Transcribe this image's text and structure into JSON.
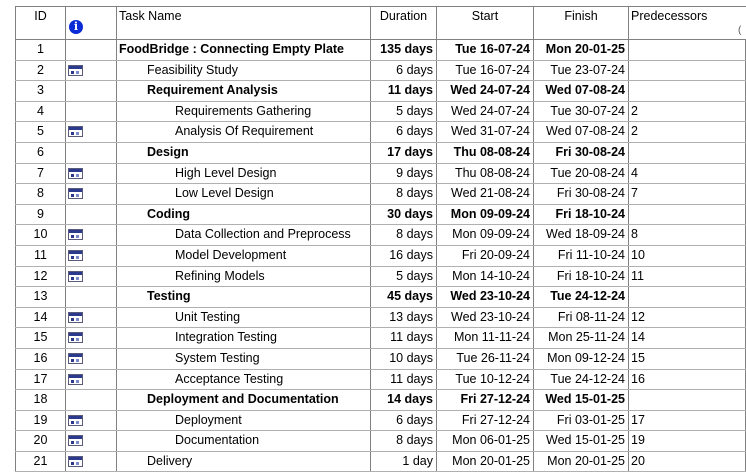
{
  "columns": {
    "id": "ID",
    "task_name": "Task Name",
    "duration": "Duration",
    "start": "Start",
    "finish": "Finish",
    "predecessors": "Predecessors"
  },
  "header_indicator_icon": "info-icon",
  "edge_fragment": "(",
  "tasks": [
    {
      "id": "1",
      "indent": 0,
      "bold": true,
      "icon": "",
      "name": "FoodBridge : Connecting Empty Plate",
      "duration": "135 days",
      "start": "Tue 16-07-24",
      "finish": "Mon 20-01-25",
      "pred": ""
    },
    {
      "id": "2",
      "indent": 1,
      "bold": false,
      "icon": "calendar-icon",
      "name": "Feasibility Study",
      "duration": "6 days",
      "start": "Tue 16-07-24",
      "finish": "Tue 23-07-24",
      "pred": ""
    },
    {
      "id": "3",
      "indent": 1,
      "bold": true,
      "icon": "",
      "name": "Requirement Analysis",
      "duration": "11 days",
      "start": "Wed 24-07-24",
      "finish": "Wed 07-08-24",
      "pred": ""
    },
    {
      "id": "4",
      "indent": 2,
      "bold": false,
      "icon": "",
      "name": "Requirements Gathering",
      "duration": "5 days",
      "start": "Wed 24-07-24",
      "finish": "Tue 30-07-24",
      "pred": "2"
    },
    {
      "id": "5",
      "indent": 2,
      "bold": false,
      "icon": "calendar-icon",
      "name": "Analysis Of Requirement",
      "duration": "6 days",
      "start": "Wed 31-07-24",
      "finish": "Wed 07-08-24",
      "pred": "2"
    },
    {
      "id": "6",
      "indent": 1,
      "bold": true,
      "icon": "",
      "name": "Design",
      "duration": "17 days",
      "start": "Thu 08-08-24",
      "finish": "Fri 30-08-24",
      "pred": ""
    },
    {
      "id": "7",
      "indent": 2,
      "bold": false,
      "icon": "calendar-icon",
      "name": "High Level Design",
      "duration": "9 days",
      "start": "Thu 08-08-24",
      "finish": "Tue 20-08-24",
      "pred": "4"
    },
    {
      "id": "8",
      "indent": 2,
      "bold": false,
      "icon": "calendar-icon",
      "name": "Low Level Design",
      "duration": "8 days",
      "start": "Wed 21-08-24",
      "finish": "Fri 30-08-24",
      "pred": "7"
    },
    {
      "id": "9",
      "indent": 1,
      "bold": true,
      "icon": "",
      "name": "Coding",
      "duration": "30 days",
      "start": "Mon 09-09-24",
      "finish": "Fri 18-10-24",
      "pred": ""
    },
    {
      "id": "10",
      "indent": 2,
      "bold": false,
      "icon": "calendar-icon",
      "name": "Data Collection and Preprocess",
      "duration": "8 days",
      "start": "Mon 09-09-24",
      "finish": "Wed 18-09-24",
      "pred": "8"
    },
    {
      "id": "11",
      "indent": 2,
      "bold": false,
      "icon": "calendar-icon",
      "name": "Model Development",
      "duration": "16 days",
      "start": "Fri 20-09-24",
      "finish": "Fri 11-10-24",
      "pred": "10"
    },
    {
      "id": "12",
      "indent": 2,
      "bold": false,
      "icon": "calendar-icon",
      "name": "Refining Models",
      "duration": "5 days",
      "start": "Mon 14-10-24",
      "finish": "Fri 18-10-24",
      "pred": "11"
    },
    {
      "id": "13",
      "indent": 1,
      "bold": true,
      "icon": "",
      "name": "Testing",
      "duration": "45 days",
      "start": "Wed 23-10-24",
      "finish": "Tue 24-12-24",
      "pred": ""
    },
    {
      "id": "14",
      "indent": 2,
      "bold": false,
      "icon": "calendar-icon",
      "name": "Unit Testing",
      "duration": "13 days",
      "start": "Wed 23-10-24",
      "finish": "Fri 08-11-24",
      "pred": "12"
    },
    {
      "id": "15",
      "indent": 2,
      "bold": false,
      "icon": "calendar-icon",
      "name": "Integration Testing",
      "duration": "11 days",
      "start": "Mon 11-11-24",
      "finish": "Mon 25-11-24",
      "pred": "14"
    },
    {
      "id": "16",
      "indent": 2,
      "bold": false,
      "icon": "calendar-icon",
      "name": "System Testing",
      "duration": "10 days",
      "start": "Tue 26-11-24",
      "finish": "Mon 09-12-24",
      "pred": "15"
    },
    {
      "id": "17",
      "indent": 2,
      "bold": false,
      "icon": "calendar-icon",
      "name": "Acceptance Testing",
      "duration": "11 days",
      "start": "Tue 10-12-24",
      "finish": "Tue 24-12-24",
      "pred": "16"
    },
    {
      "id": "18",
      "indent": 1,
      "bold": true,
      "icon": "",
      "name": "Deployment and Documentation",
      "duration": "14 days",
      "start": "Fri 27-12-24",
      "finish": "Wed 15-01-25",
      "pred": ""
    },
    {
      "id": "19",
      "indent": 2,
      "bold": false,
      "icon": "calendar-icon",
      "name": "Deployment",
      "duration": "6 days",
      "start": "Fri 27-12-24",
      "finish": "Fri 03-01-25",
      "pred": "17"
    },
    {
      "id": "20",
      "indent": 2,
      "bold": false,
      "icon": "calendar-icon",
      "name": "Documentation",
      "duration": "8 days",
      "start": "Mon 06-01-25",
      "finish": "Wed 15-01-25",
      "pred": "19"
    },
    {
      "id": "21",
      "indent": 1,
      "bold": false,
      "icon": "calendar-icon",
      "name": "Delivery",
      "duration": "1 day",
      "start": "Mon 20-01-25",
      "finish": "Mon 20-01-25",
      "pred": "20"
    }
  ]
}
